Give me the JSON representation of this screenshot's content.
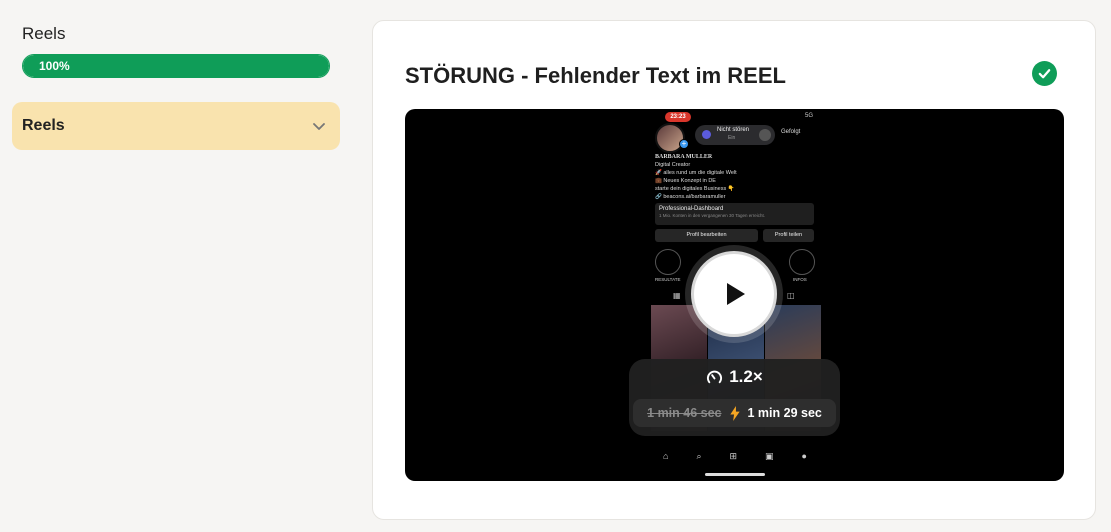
{
  "sidebar": {
    "course_title": "Reels",
    "progress_percent": 100,
    "progress_label": "100%",
    "section_label": "Reels"
  },
  "lesson": {
    "title": "STÖRUNG - Fehlender Text im REEL",
    "completed": true
  },
  "video": {
    "speed": "1.2×",
    "original_duration": "1 min 46 sec",
    "new_duration": "1 min 29 sec",
    "phone": {
      "time": "23:23",
      "network": "5G",
      "dnd_label": "Nicht stören",
      "dnd_sub": "Ein",
      "follow_label": "Gefolgt",
      "profile_name": "BARBARA MULLER",
      "bio_lines": [
        "Digital Creator",
        "🚀 alles rund um die digitale Welt",
        "💼 Neues Konzept in DE",
        "starte dein digitales Business 👇",
        "🔗 beacons.ai/barbaramuller"
      ],
      "dashboard_title": "Professional-Dashboard",
      "dashboard_sub": "1 Mio. Konten in den vergangenen 30 Tagen erreicht.",
      "edit_profile": "Profil bearbeiten",
      "share_profile": "Profil teilen",
      "highlight_1": "RESULTATE",
      "highlight_4": "INFOS"
    }
  },
  "colors": {
    "accent_green": "#0f9d58",
    "section_bg": "#f9e3ae",
    "lightning": "#f5a623"
  },
  "icons": [
    "chevron-down-icon",
    "check-circle-icon",
    "play-icon",
    "speedometer-icon",
    "lightning-icon"
  ]
}
